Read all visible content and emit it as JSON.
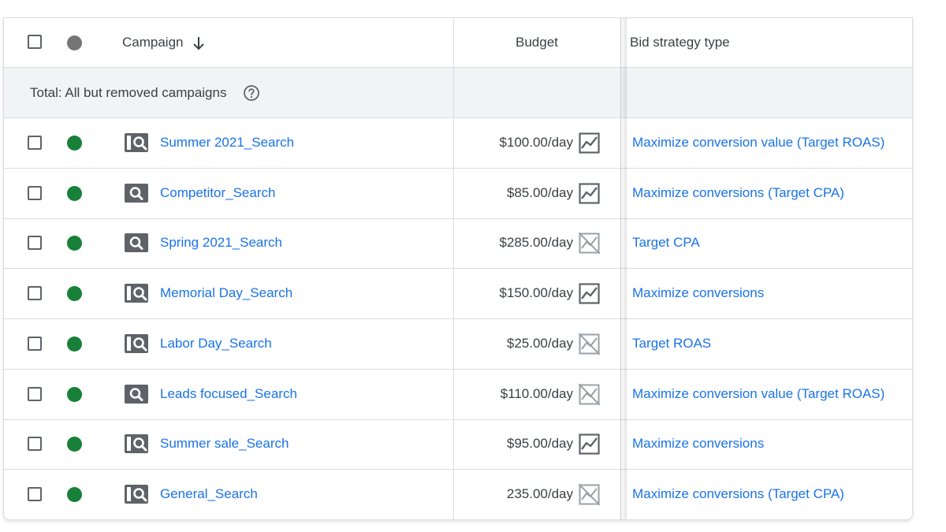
{
  "header": {
    "campaign_label": "Campaign",
    "budget_label": "Budget",
    "bid_label": "Bid strategy type"
  },
  "total": {
    "label": "Total: All but removed campaigns"
  },
  "colors": {
    "link": "#1a73e8",
    "enabled_status": "#188038",
    "status_header": "#757575"
  },
  "rows": [
    {
      "campaign": "Summer 2021_Search",
      "budget": "$100.00/day",
      "bid": "Maximize conversion value (Target ROAS)",
      "campaign_icon": "search-campaign-icon",
      "budget_icon": "performance-chart-icon",
      "status": "enabled"
    },
    {
      "campaign": "Competitor_Search",
      "budget": "$85.00/day",
      "bid": "Maximize conversions (Target CPA)",
      "campaign_icon": "search-filled-icon",
      "budget_icon": "performance-chart-icon",
      "status": "enabled"
    },
    {
      "campaign": "Spring 2021_Search",
      "budget": "$285.00/day",
      "bid": "Target CPA",
      "campaign_icon": "search-filled-icon",
      "budget_icon": "chart-disabled-icon",
      "status": "enabled"
    },
    {
      "campaign": "Memorial Day_Search",
      "budget": "$150.00/day",
      "bid": "Maximize conversions",
      "campaign_icon": "search-campaign-icon",
      "budget_icon": "performance-chart-icon",
      "status": "enabled"
    },
    {
      "campaign": "Labor Day_Search",
      "budget": "$25.00/day",
      "bid": "Target ROAS",
      "campaign_icon": "search-campaign-icon",
      "budget_icon": "chart-disabled-icon",
      "status": "enabled"
    },
    {
      "campaign": "Leads focused_Search",
      "budget": "$110.00/day",
      "bid": "Maximize conversion value (Target ROAS)",
      "campaign_icon": "search-filled-icon",
      "budget_icon": "chart-disabled-icon",
      "status": "enabled"
    },
    {
      "campaign": "Summer sale_Search",
      "budget": "$95.00/day",
      "bid": "Maximize conversions",
      "campaign_icon": "search-campaign-icon",
      "budget_icon": "performance-chart-icon",
      "status": "enabled"
    },
    {
      "campaign": "General_Search",
      "budget": "235.00/day",
      "bid": "Maximize conversions (Target CPA)",
      "campaign_icon": "search-campaign-icon",
      "budget_icon": "chart-disabled-icon",
      "status": "enabled"
    }
  ]
}
